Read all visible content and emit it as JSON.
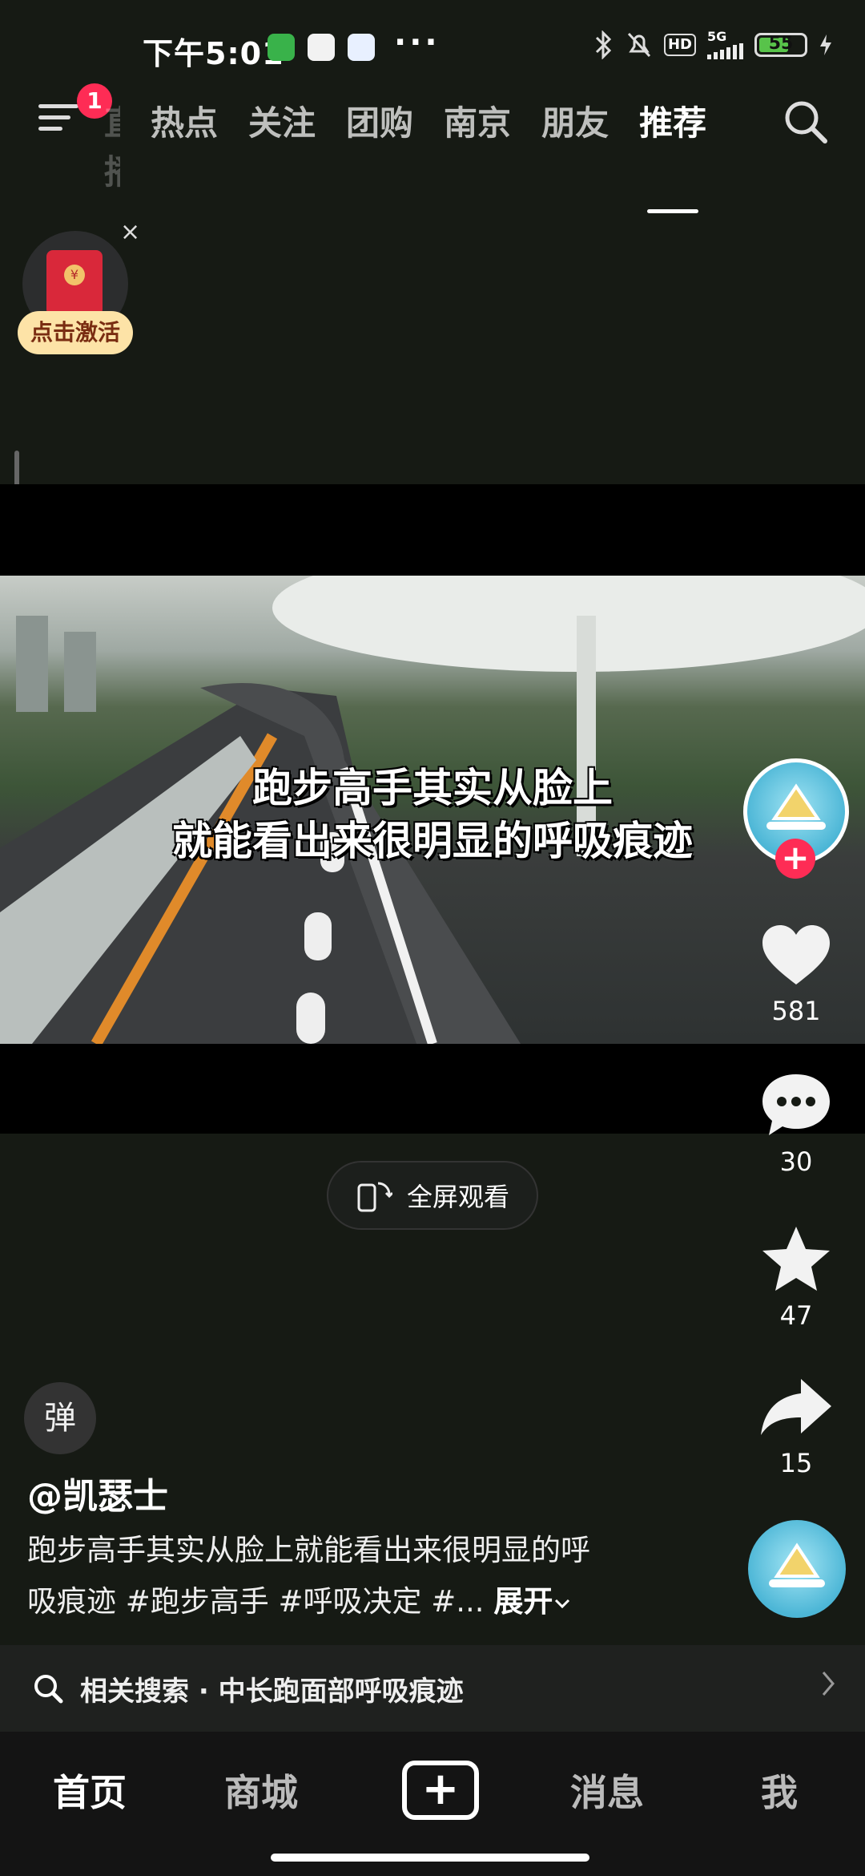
{
  "status_bar": {
    "time": "下午5:01",
    "more": "···",
    "network": "5G",
    "hd": "HD",
    "battery": "55"
  },
  "top_nav": {
    "notification_count": "1",
    "tabs": [
      {
        "label": "直播"
      },
      {
        "label": "热点"
      },
      {
        "label": "关注"
      },
      {
        "label": "团购"
      },
      {
        "label": "南京"
      },
      {
        "label": "朋友"
      },
      {
        "label": "推荐"
      }
    ]
  },
  "red_packet": {
    "label": "点击激活",
    "close": "×",
    "seal": "¥"
  },
  "video": {
    "subtitle_line1": "跑步高手其实从脸上",
    "subtitle_line2": "就能看出来很明显的呼吸痕迹"
  },
  "right_rail": {
    "likes": "581",
    "comments": "30",
    "favorites": "47",
    "shares": "15"
  },
  "fullscreen": {
    "label": "全屏观看"
  },
  "post": {
    "danmu_label": "弹",
    "author": "@凯瑟士",
    "desc_line1": "跑步高手其实从脸上就能看出来很明显的呼",
    "desc_line2": "吸痕迹 #跑步高手 #呼吸决定 #...",
    "expand": "展开"
  },
  "related_search": {
    "text": "相关搜索 · 中长跑面部呼吸痕迹"
  },
  "bottom_nav": {
    "items": [
      {
        "label": "首页"
      },
      {
        "label": "商城"
      },
      {
        "label": "消息"
      },
      {
        "label": "我"
      }
    ]
  },
  "colors": {
    "accent": "#fe2c55",
    "background": "#161a14",
    "red_packet_label_bg": "#fde3a7"
  }
}
